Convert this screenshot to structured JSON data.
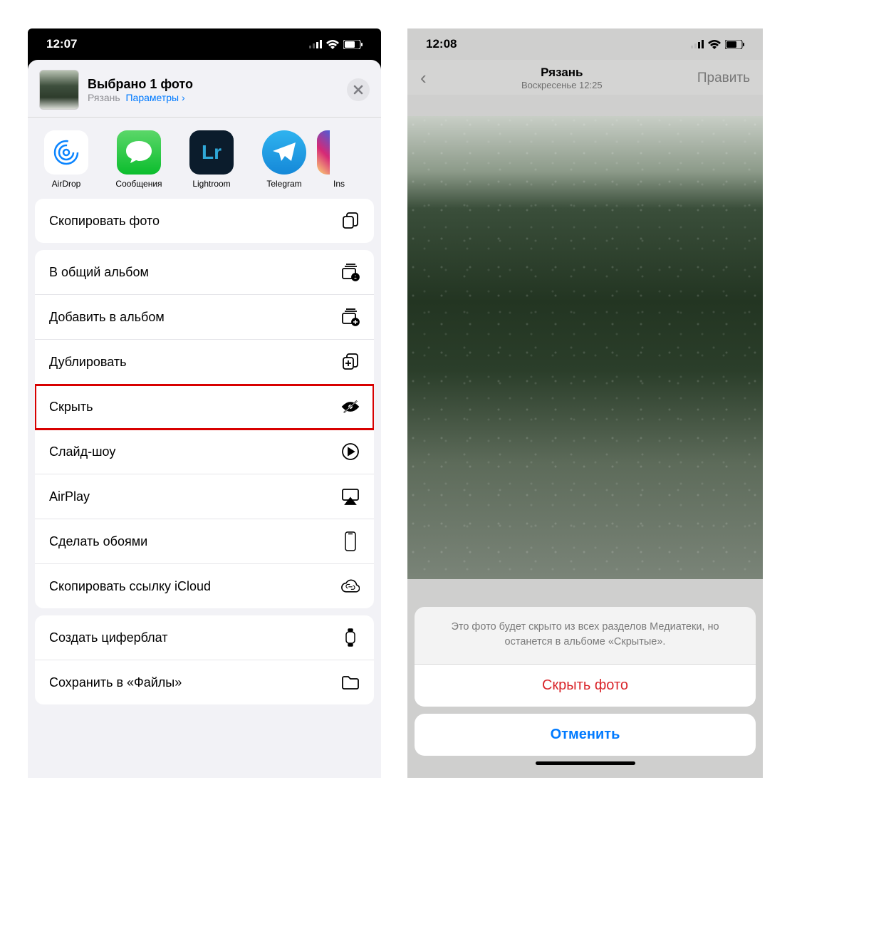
{
  "left": {
    "status_time": "12:07",
    "header": {
      "title": "Выбрано 1 фото",
      "location": "Рязань",
      "params_label": "Параметры"
    },
    "apps": [
      {
        "label": "AirDrop",
        "icon": "airdrop"
      },
      {
        "label": "Сообщения",
        "icon": "messages"
      },
      {
        "label": "Lightroom",
        "icon": "lightroom"
      },
      {
        "label": "Telegram",
        "icon": "telegram"
      },
      {
        "label": "Ins",
        "icon": "instagram"
      }
    ],
    "groups": [
      [
        {
          "label": "Скопировать фото",
          "icon": "copy",
          "hl": false
        }
      ],
      [
        {
          "label": "В общий альбом",
          "icon": "shared-album",
          "hl": false
        },
        {
          "label": "Добавить в альбом",
          "icon": "add-album",
          "hl": false
        },
        {
          "label": "Дублировать",
          "icon": "duplicate",
          "hl": false
        },
        {
          "label": "Скрыть",
          "icon": "hide",
          "hl": true
        },
        {
          "label": "Слайд-шоу",
          "icon": "slideshow",
          "hl": false
        },
        {
          "label": "AirPlay",
          "icon": "airplay",
          "hl": false
        },
        {
          "label": "Сделать обоями",
          "icon": "wallpaper",
          "hl": false
        },
        {
          "label": "Скопировать ссылку iCloud",
          "icon": "icloud-link",
          "hl": false
        }
      ],
      [
        {
          "label": "Создать циферблат",
          "icon": "watchface",
          "hl": false
        },
        {
          "label": "Сохранить в «Файлы»",
          "icon": "files",
          "hl": false
        }
      ]
    ]
  },
  "right": {
    "status_time": "12:08",
    "nav": {
      "title": "Рязань",
      "subtitle": "Воскресенье 12:25",
      "edit_label": "Править"
    },
    "alert": {
      "message": "Это фото будет скрыто из всех разделов Медиатеки, но останется в альбоме «Скрытые».",
      "confirm": "Скрыть фото",
      "cancel": "Отменить"
    }
  }
}
